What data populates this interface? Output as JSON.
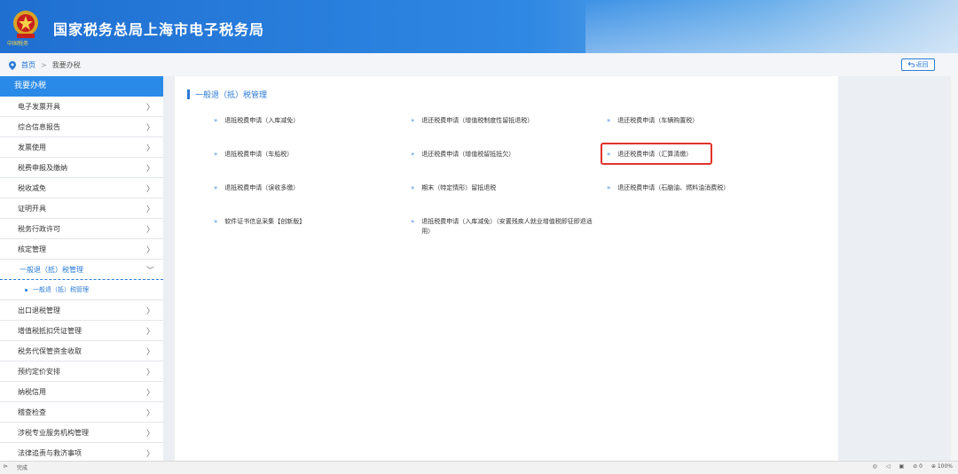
{
  "header": {
    "title": "国家税务总局上海市电子税务局",
    "emblem_text": "中国税务"
  },
  "breadcrumb": {
    "home": "首页",
    "separator": ">",
    "current": "我要办税"
  },
  "back_button": "返回",
  "sidebar": {
    "title": "我要办税",
    "items_top": [
      {
        "label": "电子发票开具"
      },
      {
        "label": "综合信息报告"
      },
      {
        "label": "发票使用"
      },
      {
        "label": "税费申报及缴纳"
      },
      {
        "label": "税收减免"
      },
      {
        "label": "证明开具"
      },
      {
        "label": "税务行政许可"
      },
      {
        "label": "核定管理"
      }
    ],
    "expanded_item": "一般退（抵）税管理",
    "sub_item": "一般退（抵）税管理",
    "items_bottom": [
      {
        "label": "出口退税管理"
      },
      {
        "label": "增值税抵扣凭证管理"
      },
      {
        "label": "税务代保管资金收取"
      },
      {
        "label": "预约定价安排"
      },
      {
        "label": "纳税信用"
      },
      {
        "label": "稽查检查"
      },
      {
        "label": "涉税专业服务机构管理"
      },
      {
        "label": "法律追责与救济事项"
      }
    ]
  },
  "panel": {
    "title": "一般退（抵）税管理",
    "links": [
      {
        "label": "退抵税费申请（入库减免）"
      },
      {
        "label": "退还税费申请（增值税制度性留抵退税）"
      },
      {
        "label": "退还税费申请（车辆购置税）"
      },
      {
        "label": "退抵税费申请（车船税）"
      },
      {
        "label": "退还税费申请（增值税留抵抵欠）"
      },
      {
        "label": "退还税费申请（汇算清缴）"
      },
      {
        "label": "退抵税费申请（误收多缴）"
      },
      {
        "label": "期末（特定情形）留抵退税"
      },
      {
        "label": "退还税费申请（石脑油、燃料油消费税）"
      },
      {
        "label": "软件证书信息采集【创新版】"
      },
      {
        "label": "退抵税费申请（入库减免）（安置残疾人就业增值税即征即退适用）"
      }
    ]
  },
  "statusbar": {
    "left_status": "完成",
    "right_counts": "0",
    "zoom": "100%"
  },
  "colors": {
    "accent": "#2a7ad6",
    "highlight": "#e0332a",
    "header": "#1f6fd1"
  }
}
